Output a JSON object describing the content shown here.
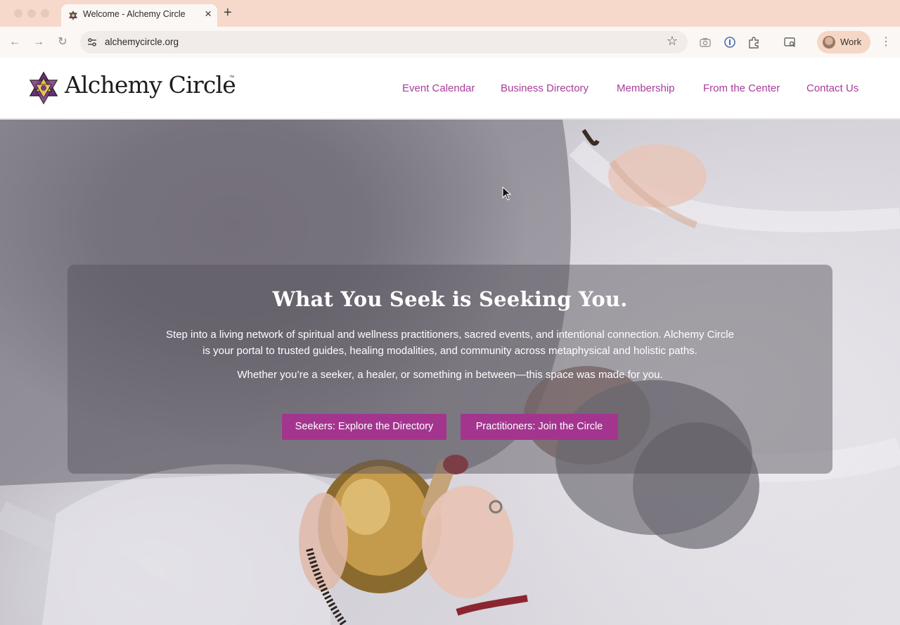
{
  "browser": {
    "tab_title": "Welcome - Alchemy Circle",
    "url": "alchemycircle.org",
    "profile_label": "Work"
  },
  "site": {
    "logo_text": "Alchemy Circle",
    "logo_tm": "™",
    "nav": [
      "Event Calendar",
      "Business Directory",
      "Membership",
      "From the Center",
      "Contact Us"
    ]
  },
  "hero": {
    "headline": "What You Seek is Seeking You.",
    "paragraph1": "Step into a living network of spiritual and wellness practitioners, sacred events, and intentional connection. Alchemy Circle is your portal to trusted guides, healing modalities, and community across metaphysical and holistic paths.",
    "paragraph2": "Whether you’re a seeker, a healer, or something in between—this space was made for you.",
    "cta_seekers": "Seekers: Explore the Directory",
    "cta_practitioners": "Practitioners: Join the Circle"
  },
  "colors": {
    "brand": "#a83c9a",
    "button": "#a3358f",
    "chrome_tabbar": "#f6d9cb"
  },
  "icons": [
    "back-icon",
    "forward-icon",
    "reload-icon",
    "site-settings-icon",
    "bookmark-star-icon",
    "camera-icon",
    "password-manager-icon",
    "extensions-icon",
    "side-panel-icon",
    "menu-icon"
  ]
}
